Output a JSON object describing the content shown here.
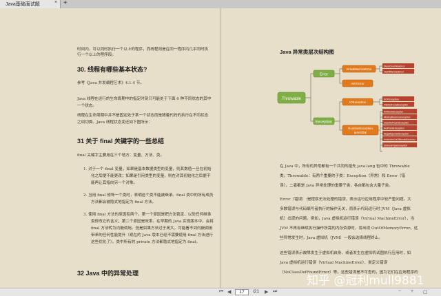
{
  "tab": {
    "title": "Java基础面试题",
    "close": "×",
    "new": "+"
  },
  "left": {
    "intro": [
      "时间内，可以同时执行一个以上的程序，而线程则是在同一程序内几乎同时执",
      "行一个以上的程序段。"
    ],
    "h30": "30. 线程有哪些基本状态?",
    "ref": "参考《Java 并发编程艺术》4.1.4 节。",
    "p1": [
      "Java 线程在运行的生命周期中的指定时刻只可能处于下面 6 种不同状态的其中",
      "一个状态。"
    ],
    "p2": [
      "线程在生命周期中并不是固定处于某一个状态而是随着代码的执行在不同状态",
      "之间切换。Java 线程状态变迁如下图所示："
    ],
    "h31": "31 关于 final 关键字的一些总结",
    "p3": "final 关键字主要用在三个地方：变量、方法、类。",
    "items": [
      [
        "1.  对于一个 final 变量，如果是基本数据类型的变量，则其数值一旦在初始",
        "化之后便不能更改；如果是引用类型的变量，则在对其初始化之后便不",
        "能再让其指向另一个对象。"
      ],
      [
        "2.  当用 final 修饰一个类时，表明这个类不能被继承。final 类中的所有成员",
        "方法都会被隐式地指定为 final 方法。"
      ],
      [
        "3.  使用 final 方法的原因有两个。第一个原因是把方法锁定，以防任何继承",
        "类修改它的含义；第二个原因是效率。在早期的 Java 实现版本中，会将",
        "final 方法转为内嵌调用。但是如果方法过于庞大，可能看不到内嵌调用",
        "带来的任何性能提升（现在的 Java 版本已经不需要使用 final 方法进行",
        "这些优化了）。类中所有的 private 方法都隐式地指定为 final。"
      ]
    ],
    "h32": "32 Java 中的异常处理"
  },
  "right": {
    "h": "Java 异常类层次结构图",
    "diagram": {
      "root": "Throwable",
      "error": "Error",
      "exception": "Exception",
      "vme": "VirtualMachineError",
      "awt": "AWTError",
      "io": "IOException",
      "rte": "RuntimeException",
      "rte_sub": "运行时异常",
      "vme_kids": [
        "StackOverFlowError",
        "OutOfMemoryError"
      ],
      "io_kids": [
        "EOFException",
        "FileNotFoundException"
      ],
      "rte_kids": [
        "ArithmeticException",
        "MissingResourceException",
        "ClassNotFoundException",
        "NullPointerException",
        "IllegalArgumentException",
        "ArrayIndexOutOfBoundsException",
        "UnknownTypeException"
      ]
    },
    "p1": [
      "在 Java 中，所有的异常都有一个共同的祖先 java.lang 包中的 Throwable",
      "类。Throwable：有两个重要的子类：Exception（异常）和 Error（错",
      "误），二者都是 Java 异常处理的重要子类，各自都包含大量子类。"
    ],
    "p2": [
      "Error（错误）:是程序无法处理的错误，表示运行应用程序中较严重问题。大",
      "多数错误与代码编写者执行的操作无关，而表示代码运行时 JVM（Java 虚拟",
      "机）出现的问题。例如，Java 虚拟机运行错误（Virtual MachineError），当",
      "JVM 不再有继续执行操作所需的内存资源时，将出现 OutOfMemoryError。这",
      "些异常发生时，Java 虚拟机（JVM）一般会选择线程终止。"
    ],
    "p3": [
      "这些错误表示故障发生于虚拟机自身、或者发生在虚拟机试图执行应用时，如",
      "Java 虚拟机运行错误（Virtual MachineError）、类定义错误",
      "（NoClassDefFoundError）等。这些错误是不可查的，因为它们在应用程序的"
    ]
  },
  "toolbar": {
    "current_page": "17",
    "total": "/21"
  },
  "watermark": "知乎 @冠利mull9881"
}
